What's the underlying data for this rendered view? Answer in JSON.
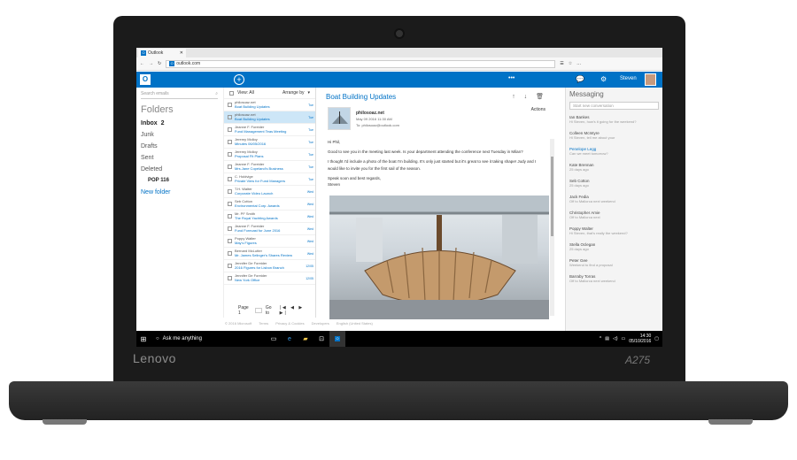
{
  "laptop": {
    "brand": "Lenovo",
    "model": "A275"
  },
  "browser": {
    "tab_label": "Outlook",
    "url": "outlook.com"
  },
  "appbar": {
    "app_letter": "O",
    "dots": "•••",
    "user_name": "Steven"
  },
  "folders": {
    "search_placeholder": "Search emails",
    "title": "Folders",
    "items": [
      {
        "label": "Inbox",
        "count": "2",
        "bold": true
      },
      {
        "label": "Junk"
      },
      {
        "label": "Drafts"
      },
      {
        "label": "Sent"
      },
      {
        "label": "Deleted"
      },
      {
        "label": "POP",
        "count": "116",
        "bold": true
      },
      {
        "label": "New folder",
        "link": true
      }
    ]
  },
  "list": {
    "view": "View: All",
    "arrange": "Arrange by",
    "messages": [
      {
        "from": "philosoaz.net",
        "subject": "Boat Building Updates",
        "date": "Tue"
      },
      {
        "from": "philosoaz.net",
        "subject": "Boat Building Updates",
        "date": "Tue",
        "selected": true
      },
      {
        "from": "Jeanne F. Foreider",
        "subject": "Fund Management Teas Meeting",
        "date": "Tue"
      },
      {
        "from": "Jeremy Molloy",
        "subject": "Minutes 06/05/2016",
        "date": "Tue"
      },
      {
        "from": "Jeremy Molloy",
        "subject": "Proposal Fit Plans",
        "date": "Tue"
      },
      {
        "from": "Jeanne F. Foreider",
        "subject": "Mrs.Jane Copeland's Business",
        "date": "Tue"
      },
      {
        "from": "C. Holdvige",
        "subject": "Private View for Fund Managers",
        "date": "Tue"
      },
      {
        "from": "T.H. Walter",
        "subject": "Corporate Video Launch",
        "date": "Wed"
      },
      {
        "from": "Seb Cotton",
        "subject": "Environmental Corp. Awards",
        "date": "Wed"
      },
      {
        "from": "Mr. PF Smith",
        "subject": "The Royal Yachting Awards",
        "date": "Wed"
      },
      {
        "from": "Jeanne F. Foreider",
        "subject": "Fund Forecast for June 2016",
        "date": "Wed"
      },
      {
        "from": "Poppy Walter",
        "subject": "May's Figures",
        "date": "Wed"
      },
      {
        "from": "Bernard McLutter",
        "subject": "Mr. James Selinger's Shares Review",
        "date": "Wed"
      },
      {
        "from": "Jennifer De Foreider",
        "subject": "2016 Figures for Lisbon Branch",
        "date": "12/05"
      },
      {
        "from": "Jennifer De Foreider",
        "subject": "New York Office",
        "date": "12/05"
      }
    ],
    "pager": {
      "page": "Page 1",
      "goto": "Go to"
    }
  },
  "reading": {
    "title": "Boat Building Updates",
    "actions": "Actions",
    "from": "philosoaz.net",
    "date": "May 09 2016 11:30 AM",
    "to": "To: philosoaz@outlook.com",
    "greeting": "Hi Phil,",
    "para1": "Good to see you in the meeting last week. Is your department attending the conference next Tuesday in Milan?",
    "para2": "I thought I'd include a photo of the boat I'm building. It's only just started but it's great to see it taking shape! Judy and I would like to invite you for the first sail of the season.",
    "signoff": "Speak soon and best regards,",
    "signature": "Steven"
  },
  "messaging": {
    "title": "Messaging",
    "new_placeholder": "Start new conversation",
    "contacts": [
      {
        "name": "Ian Bankes",
        "status": "Hi Steven, how's it going for the weekend?"
      },
      {
        "name": "Colleen McIntyre",
        "status": "Hi Steven, tell me about your"
      },
      {
        "name": "Penelope Legg",
        "status": "Can we meet tomorrow?",
        "highlight": true
      },
      {
        "name": "Kate Brennan",
        "status": "25 days ago"
      },
      {
        "name": "Seb Cotton",
        "status": "25 days ago"
      },
      {
        "name": "Jack Fedia",
        "status": "Off to Mallorca next weekend"
      },
      {
        "name": "Christopher Amie",
        "status": "Off to Mallorca next"
      },
      {
        "name": "Poppy Walter",
        "status": "Hi Steven, that's really the weekend?"
      },
      {
        "name": "Stella Oclegan",
        "status": "25 days ago"
      },
      {
        "name": "Peter Gee",
        "status": "Weekend to find a proposal"
      },
      {
        "name": "Barraby Torras",
        "status": "Off to Mallorca next weekend"
      }
    ]
  },
  "footer": [
    "© 2016 Microsoft",
    "Terms",
    "Privacy & Cookies",
    "Developers",
    "English (United States)"
  ],
  "taskbar": {
    "search": "Ask me anything",
    "time": "14:30",
    "date": "05/10/2016"
  },
  "colors": {
    "outlook_blue": "#0072c6",
    "taskbar": "#000000"
  }
}
